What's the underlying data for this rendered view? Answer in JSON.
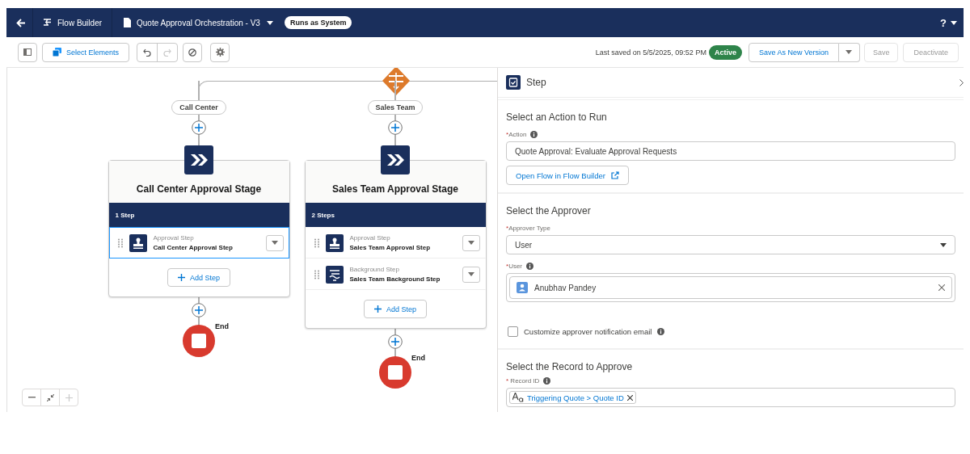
{
  "header": {
    "app_title": "Flow Builder",
    "flow_name": "Quote Approval Orchestration - V3",
    "run_mode": "Runs as System",
    "help": "?"
  },
  "toolbar": {
    "select_elements": "Select Elements",
    "last_saved": "Last saved on 5/5/2025, 09:52 PM",
    "status": "Active",
    "buttons": [
      {
        "label": "Save As New Version",
        "disabled": false,
        "kind": "split"
      },
      {
        "label": "Save",
        "disabled": true,
        "kind": "plain"
      },
      {
        "label": "Deactivate",
        "disabled": true,
        "kind": "plain"
      }
    ]
  },
  "canvas": {
    "branches": [
      {
        "label": "Call Center",
        "stage": {
          "title": "Call Center Approval Stage",
          "step_count": "1 Step",
          "add_step": "Add Step",
          "steps": [
            {
              "kind": "approval",
              "type": "Approval Step",
              "name": "Call Center Approval Step",
              "selected": true
            }
          ]
        },
        "end_label": "End"
      },
      {
        "label": "Sales Team",
        "stage": {
          "title": "Sales Team Approval Stage",
          "step_count": "2 Steps",
          "add_step": "Add Step",
          "steps": [
            {
              "kind": "approval",
              "type": "Approval Step",
              "name": "Sales Team Approval Step",
              "selected": false
            },
            {
              "kind": "background",
              "type": "Background Step",
              "name": "Sales Team Background Step",
              "selected": false
            }
          ]
        },
        "end_label": "End"
      }
    ]
  },
  "panel": {
    "title": "Step",
    "action_section": {
      "heading": "Select an Action to Run",
      "action_required": "*",
      "action_label": "Action",
      "action_value": "Quote Approval: Evaluate Approval Requests",
      "open_button": "Open Flow in Flow Builder"
    },
    "approver_section": {
      "heading": "Select the Approver",
      "type_required": "*",
      "type_label": "Approver Type",
      "type_value": "User",
      "user_required": "*",
      "user_label": "User",
      "user_value": "Anubhav Pandey",
      "notify_label": "Customize approver notification email",
      "notify_checked": false
    },
    "record_section": {
      "heading": "Select the Record to Approve",
      "record_required": "*",
      "record_label": "Record ID",
      "record_value": "Triggering Quote > Quote ID"
    }
  }
}
